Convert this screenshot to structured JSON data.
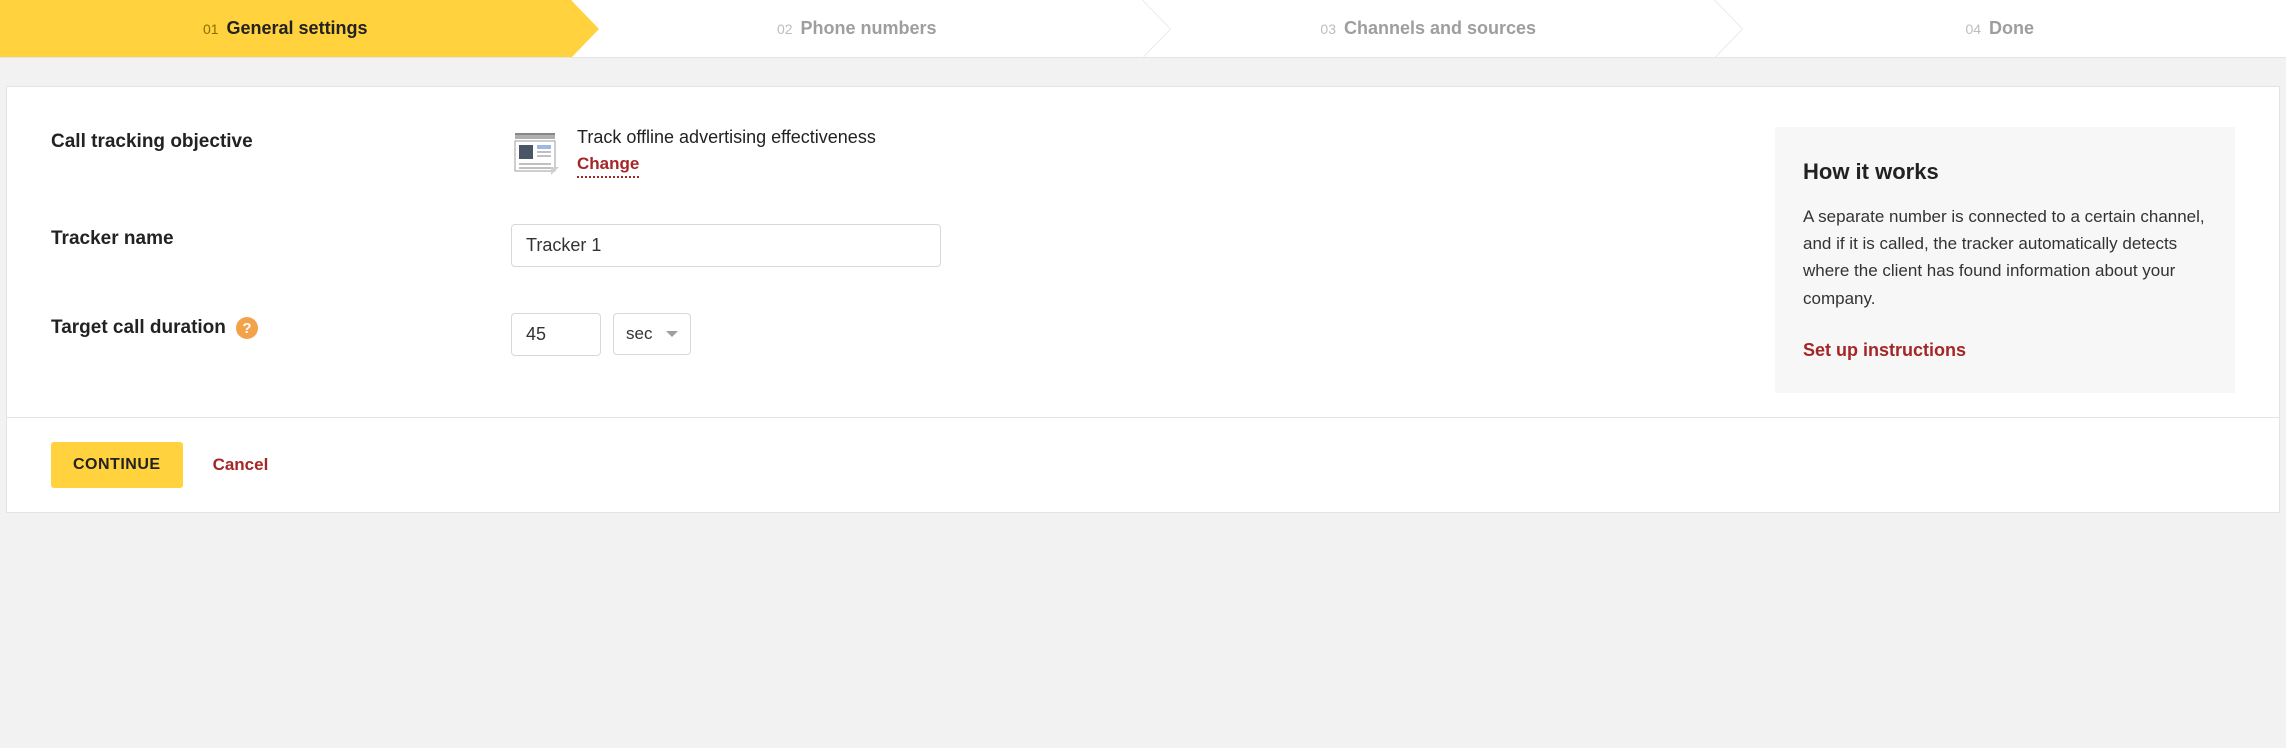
{
  "wizard": {
    "steps": [
      {
        "num": "01",
        "label": "General settings"
      },
      {
        "num": "02",
        "label": "Phone numbers"
      },
      {
        "num": "03",
        "label": "Channels and sources"
      },
      {
        "num": "04",
        "label": "Done"
      }
    ]
  },
  "form": {
    "objective_label": "Call tracking objective",
    "objective_value": "Track offline advertising effectiveness",
    "change_label": "Change",
    "tracker_name_label": "Tracker name",
    "tracker_name_value": "Tracker 1",
    "duration_label": "Target call duration",
    "duration_value": "45",
    "duration_unit": "sec"
  },
  "sidebar": {
    "title": "How it works",
    "text": "A separate number is connected to a certain channel, and if it is called, the tracker automatically detects where the client has found information about your company.",
    "link": "Set up instructions"
  },
  "actions": {
    "continue": "CONTINUE",
    "cancel": "Cancel"
  }
}
